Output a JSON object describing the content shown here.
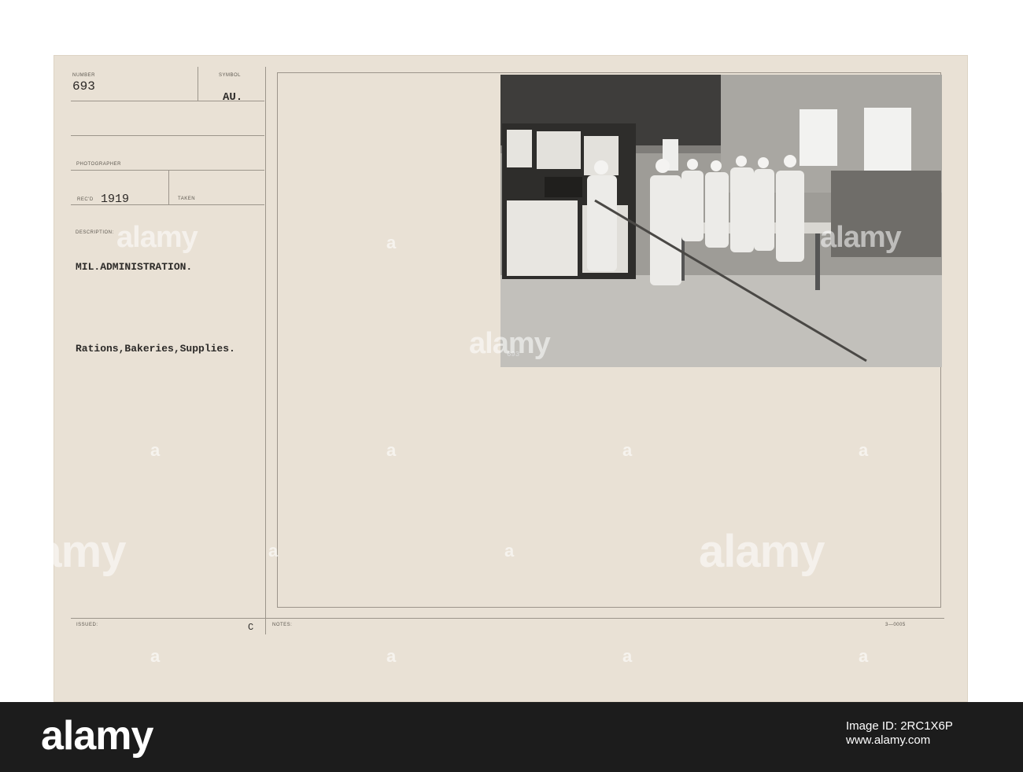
{
  "card": {
    "number_label": "NUMBER",
    "number_value": "693",
    "symbol_label": "SYMBOL",
    "symbol_value": "AU.",
    "photographer_label": "PHOTOGRAPHER",
    "recd_label": "REC'D",
    "recd_value": "1919",
    "taken_label": "TAKEN",
    "description_label": "DESCRIPTION:",
    "description_line1": "MIL.ADMINISTRATION.",
    "description_line2": "Rations,Bakeries,Supplies.",
    "issued_label": "ISSUED:",
    "issued_mark": "C",
    "notes_label": "NOTES:",
    "form_code": "3—0005"
  },
  "photo": {
    "negative_number": "693"
  },
  "watermark": {
    "text": "alamy",
    "short": "a"
  },
  "footer": {
    "logo": "alamy",
    "image_id_line1": "Image ID: 2RC1X6P",
    "image_id_line2": "www.alamy.com"
  }
}
